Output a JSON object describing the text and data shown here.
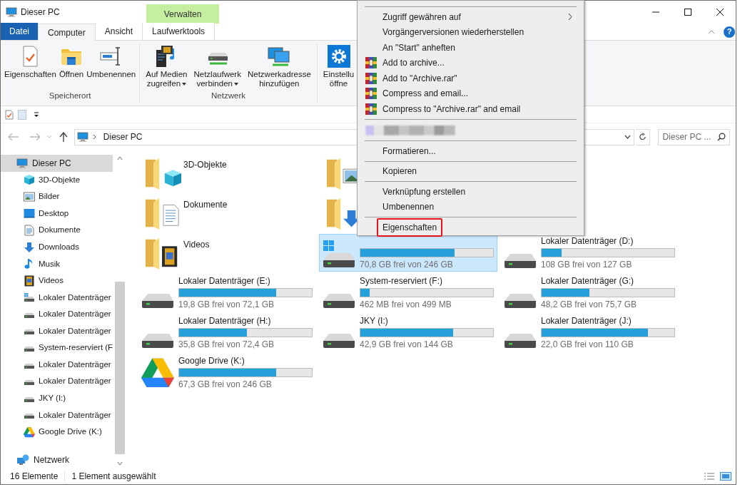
{
  "window": {
    "title": "Dieser PC",
    "help_glyph": "?"
  },
  "ribbon": {
    "contextual_header": "Verwalten",
    "tabs": [
      {
        "kind": "file",
        "label": "Datei",
        "selected": false
      },
      {
        "kind": "tab",
        "label": "Computer",
        "selected": true
      },
      {
        "kind": "tab",
        "label": "Ansicht",
        "selected": false
      },
      {
        "kind": "contextual",
        "label": "Laufwerktools",
        "selected": false
      }
    ],
    "groups": [
      {
        "label": "Speicherort",
        "buttons": [
          {
            "kind": "properties",
            "lines": [
              "Eigenschaften"
            ],
            "dropdown": false
          },
          {
            "kind": "open",
            "lines": [
              "Öffnen"
            ],
            "dropdown": false
          },
          {
            "kind": "rename",
            "lines": [
              "Umbenennen"
            ],
            "dropdown": false
          }
        ]
      },
      {
        "label": "Netzwerk",
        "buttons": [
          {
            "kind": "media",
            "lines": [
              "Auf Medien",
              "zugreifen"
            ],
            "dropdown": true
          },
          {
            "kind": "netdrive",
            "lines": [
              "Netzlaufwerk",
              "verbinden"
            ],
            "dropdown": true
          },
          {
            "kind": "netaddress",
            "lines": [
              "Netzwerkadresse",
              "hinzufügen"
            ],
            "dropdown": false
          }
        ]
      },
      {
        "buttons": [
          {
            "kind": "settings",
            "lines": [
              "Einstellu",
              "öffne"
            ],
            "dropdown": false
          }
        ]
      }
    ]
  },
  "address_bar": {
    "path": "Dieser PC",
    "search_placeholder": "Dieser PC ..."
  },
  "sidebar": {
    "items": [
      {
        "kind": "pc",
        "label": "Dieser PC",
        "selected": true,
        "children": [
          {
            "kind": "objects3d",
            "label": "3D-Objekte",
            "selected": false
          },
          {
            "kind": "pictures",
            "label": "Bilder",
            "selected": false
          },
          {
            "kind": "desktop",
            "label": "Desktop",
            "selected": false
          },
          {
            "kind": "documents",
            "label": "Dokumente",
            "selected": false
          },
          {
            "kind": "downloads",
            "label": "Downloads",
            "selected": false
          },
          {
            "kind": "music",
            "label": "Musik",
            "selected": false
          },
          {
            "kind": "videos",
            "label": "Videos",
            "selected": false
          },
          {
            "kind": "system_drive",
            "label": "Lokaler Datenträger",
            "selected": false
          },
          {
            "kind": "drive",
            "label": "Lokaler Datenträger",
            "selected": false
          },
          {
            "kind": "drive",
            "label": "Lokaler Datenträger",
            "selected": false
          },
          {
            "kind": "drive",
            "label": "System-reserviert (F",
            "selected": false
          },
          {
            "kind": "drive",
            "label": "Lokaler Datenträger",
            "selected": false
          },
          {
            "kind": "drive",
            "label": "Lokaler Datenträger",
            "selected": false
          },
          {
            "kind": "drive",
            "label": "JKY (I:)",
            "selected": false
          },
          {
            "kind": "drive",
            "label": "Lokaler Datenträger",
            "selected": false
          },
          {
            "kind": "cloud_drive",
            "label": "Google Drive (K:)",
            "selected": false
          }
        ]
      },
      {
        "kind": "network",
        "label": "Netzwerk",
        "selected": false
      }
    ]
  },
  "content_rows": [
    [
      {
        "kind": "folder",
        "name": "3D-Objekte",
        "selected": false
      },
      {
        "kind": "folder",
        "selected": false
      }
    ],
    [
      {
        "kind": "folder",
        "name": "Dokumente",
        "selected": false
      },
      {
        "kind": "folder",
        "selected": false
      }
    ],
    [
      {
        "kind": "folder",
        "name": "Videos",
        "selected": false
      },
      {
        "kind": "system_drive",
        "selected": true,
        "level": 0.71,
        "free": "70,8 GB frei von 246 GB"
      },
      {
        "kind": "drive",
        "name": "Lokaler Datenträger (D:)",
        "selected": false,
        "level": 0.15,
        "free": "108 GB frei von 127 GB"
      }
    ],
    [
      {
        "kind": "drive",
        "name": "Lokaler Datenträger (E:)",
        "selected": false,
        "level": 0.73,
        "free": "19,8 GB frei von 72,1 GB"
      },
      {
        "kind": "drive",
        "name": "System-reserviert (F:)",
        "selected": false,
        "level": 0.07,
        "free": "462 MB frei von 499 MB"
      },
      {
        "kind": "drive",
        "name": "Lokaler Datenträger (G:)",
        "selected": false,
        "level": 0.36,
        "free": "48,2 GB frei von 75,7 GB"
      }
    ],
    [
      {
        "kind": "drive",
        "name": "Lokaler Datenträger (H:)",
        "selected": false,
        "level": 0.51,
        "free": "35,8 GB frei von 72,4 GB"
      },
      {
        "kind": "drive",
        "name": "JKY (I:)",
        "selected": false,
        "level": 0.7,
        "free": "42,9 GB frei von 144 GB"
      },
      {
        "kind": "drive",
        "name": "Lokaler Datenträger (J:)",
        "selected": false,
        "level": 0.8,
        "free": "22,0 GB frei von 110 GB"
      }
    ],
    [
      {
        "kind": "cloud_drive",
        "name": "Google Drive (K:)",
        "selected": false,
        "level": 0.73,
        "free": "67,3 GB frei von 246 GB"
      }
    ]
  ],
  "context_menu": {
    "items": [
      {
        "kind": "separator"
      },
      {
        "kind": "item",
        "label": "Zugriff gewähren auf",
        "submenu": true,
        "highlighted": false
      },
      {
        "kind": "item",
        "label": "Vorgängerversionen wiederherstellen",
        "submenu": false,
        "highlighted": false
      },
      {
        "kind": "item",
        "label": "An \"Start\" anheften",
        "submenu": false,
        "highlighted": false
      },
      {
        "kind": "rar",
        "label": "Add to archive...",
        "submenu": false,
        "highlighted": false
      },
      {
        "kind": "rar",
        "label": "Add to \"Archive.rar\"",
        "submenu": false,
        "highlighted": false
      },
      {
        "kind": "rar",
        "label": "Compress and email...",
        "submenu": false,
        "highlighted": false
      },
      {
        "kind": "rar",
        "label": "Compress to \"Archive.rar\" and email",
        "submenu": false,
        "highlighted": false
      },
      {
        "kind": "separator"
      },
      {
        "kind": "redacted"
      },
      {
        "kind": "separator"
      },
      {
        "kind": "item",
        "label": "Formatieren...",
        "submenu": false,
        "highlighted": false
      },
      {
        "kind": "separator"
      },
      {
        "kind": "item",
        "label": "Kopieren",
        "submenu": false,
        "highlighted": false
      },
      {
        "kind": "separator"
      },
      {
        "kind": "item",
        "label": "Verknüpfung erstellen",
        "submenu": false,
        "highlighted": false
      },
      {
        "kind": "item",
        "label": "Umbenennen",
        "submenu": false,
        "highlighted": false
      },
      {
        "kind": "separator"
      },
      {
        "kind": "item",
        "label": "Eigenschaften",
        "submenu": false,
        "highlighted": true
      }
    ]
  },
  "status_bar": {
    "item_count": "16 Elemente",
    "selection": "1 Element ausgewählt"
  }
}
